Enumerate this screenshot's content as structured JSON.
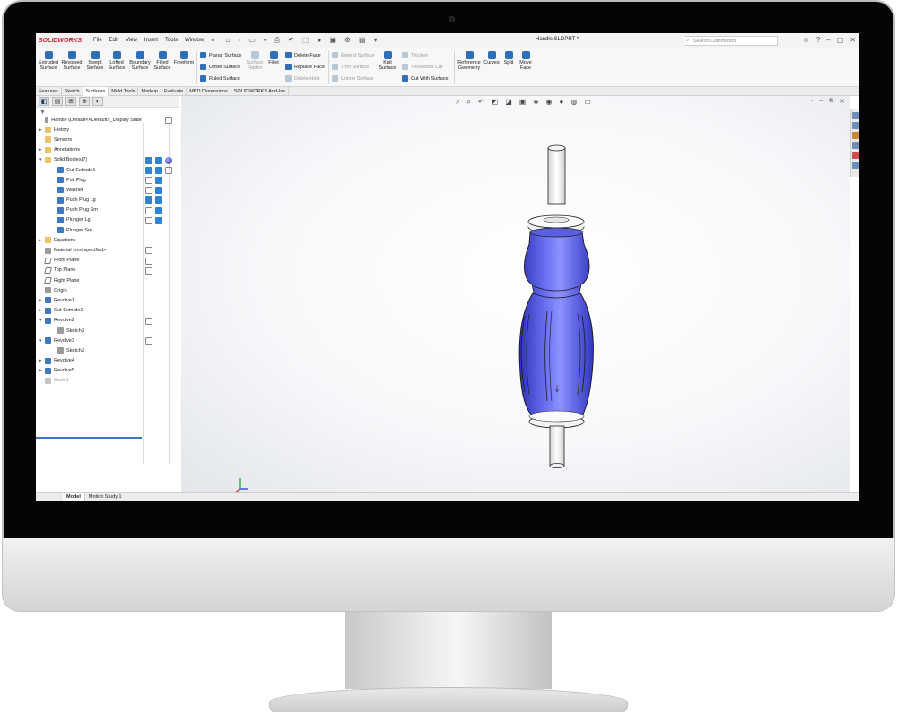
{
  "app": {
    "logo": "SOLIDWORKS",
    "doc_title": "Handle.SLDPRT *"
  },
  "menu": [
    "File",
    "Edit",
    "View",
    "Insert",
    "Tools",
    "Window"
  ],
  "search": {
    "placeholder": "Search Commands"
  },
  "ribbon": {
    "extruded": "Extruded Surface",
    "revolved": "Revolved Surface",
    "swept": "Swept Surface",
    "lofted": "Lofted Surface",
    "boundary": "Boundary Surface",
    "filled": "Filled Surface",
    "freeform": "Freeform",
    "planar": "Planar Surface",
    "offset": "Offset Surface",
    "ruled": "Ruled Surface",
    "flatten": "Surface Flatten",
    "fillet": "Fillet",
    "delete_face": "Delete Face",
    "replace_face": "Replace Face",
    "delete_hole": "Delete Hole",
    "extend": "Extend Surface",
    "trim": "Trim Surface",
    "untrim": "Untrim Surface",
    "knit": "Knit Surface",
    "thicken": "Thicken",
    "thickened_cut": "Thickened Cut",
    "cut_with_surface": "Cut With Surface",
    "ref_geom": "Reference Geometry",
    "curves": "Curves",
    "split": "Split",
    "move_face": "Move Face"
  },
  "tabs": [
    "Features",
    "Sketch",
    "Surfaces",
    "Mold Tools",
    "Markup",
    "Evaluate",
    "MBD Dimensions",
    "SOLIDWORKS Add-Ins"
  ],
  "active_tab": "Surfaces",
  "tree": {
    "root": "Handle  (Default<<Default>_Display State",
    "items": [
      {
        "label": "History",
        "depth": 1,
        "icon": "folder",
        "arrow": "▸"
      },
      {
        "label": "Sensors",
        "depth": 1,
        "icon": "folder",
        "arrow": ""
      },
      {
        "label": "Annotations",
        "depth": 1,
        "icon": "folder",
        "arrow": "▸"
      },
      {
        "label": "Solid Bodies(7)",
        "depth": 1,
        "icon": "folder",
        "arrow": "▾"
      },
      {
        "label": "Cut-Extrude1",
        "depth": 2,
        "icon": "body",
        "arrow": ""
      },
      {
        "label": "Pull Plug",
        "depth": 2,
        "icon": "body",
        "arrow": ""
      },
      {
        "label": "Washer",
        "depth": 2,
        "icon": "body",
        "arrow": ""
      },
      {
        "label": "Push Plug Lg",
        "depth": 2,
        "icon": "body",
        "arrow": ""
      },
      {
        "label": "Push Plug Sm",
        "depth": 2,
        "icon": "body",
        "arrow": ""
      },
      {
        "label": "Plunger Lg",
        "depth": 2,
        "icon": "body",
        "arrow": ""
      },
      {
        "label": "Plunger Sm",
        "depth": 2,
        "icon": "body",
        "arrow": ""
      },
      {
        "label": "Equations",
        "depth": 1,
        "icon": "folder",
        "arrow": "▸"
      },
      {
        "label": "Material <not specified>",
        "depth": 1,
        "icon": "grey",
        "arrow": ""
      },
      {
        "label": "Front Plane",
        "depth": 1,
        "icon": "plane",
        "arrow": ""
      },
      {
        "label": "Top Plane",
        "depth": 1,
        "icon": "plane",
        "arrow": ""
      },
      {
        "label": "Right Plane",
        "depth": 1,
        "icon": "plane",
        "arrow": ""
      },
      {
        "label": "Origin",
        "depth": 1,
        "icon": "grey",
        "arrow": ""
      },
      {
        "label": "Revolve1",
        "depth": 1,
        "icon": "feature",
        "arrow": "▸"
      },
      {
        "label": "Cut-Extrude1",
        "depth": 1,
        "icon": "feature",
        "arrow": "▸"
      },
      {
        "label": "Revolve2",
        "depth": 1,
        "icon": "feature",
        "arrow": "▾"
      },
      {
        "label": "Sketch3",
        "depth": 2,
        "icon": "grey",
        "arrow": ""
      },
      {
        "label": "Revolve3",
        "depth": 1,
        "icon": "feature",
        "arrow": "▾"
      },
      {
        "label": "Sketch3",
        "depth": 2,
        "icon": "grey",
        "arrow": ""
      },
      {
        "label": "Revolve4",
        "depth": 1,
        "icon": "feature",
        "arrow": "▸"
      },
      {
        "label": "Revolve5",
        "depth": 1,
        "icon": "feature",
        "arrow": "▸"
      },
      {
        "label": "Scale1",
        "depth": 1,
        "icon": "dim",
        "arrow": ""
      }
    ]
  },
  "bottom_tabs": [
    "Model",
    "Motion Study 1"
  ],
  "model_color": "#5a5fe0",
  "colors": {
    "brand": "#d21f2b",
    "accent": "#2f6fb7"
  }
}
